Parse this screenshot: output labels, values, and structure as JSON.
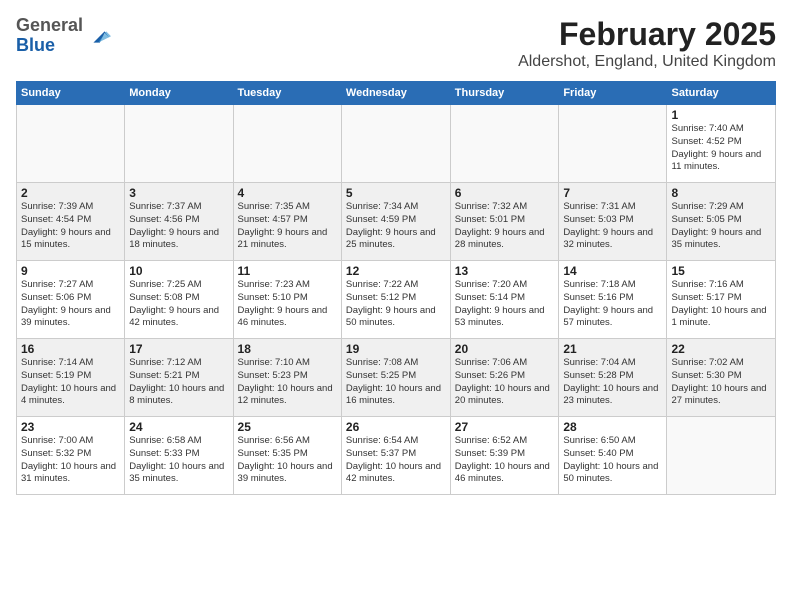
{
  "header": {
    "logo_general": "General",
    "logo_blue": "Blue",
    "title": "February 2025",
    "subtitle": "Aldershot, England, United Kingdom"
  },
  "calendar": {
    "days_of_week": [
      "Sunday",
      "Monday",
      "Tuesday",
      "Wednesday",
      "Thursday",
      "Friday",
      "Saturday"
    ],
    "weeks": [
      [
        {
          "day": "",
          "info": ""
        },
        {
          "day": "",
          "info": ""
        },
        {
          "day": "",
          "info": ""
        },
        {
          "day": "",
          "info": ""
        },
        {
          "day": "",
          "info": ""
        },
        {
          "day": "",
          "info": ""
        },
        {
          "day": "1",
          "info": "Sunrise: 7:40 AM\nSunset: 4:52 PM\nDaylight: 9 hours and 11 minutes."
        }
      ],
      [
        {
          "day": "2",
          "info": "Sunrise: 7:39 AM\nSunset: 4:54 PM\nDaylight: 9 hours and 15 minutes."
        },
        {
          "day": "3",
          "info": "Sunrise: 7:37 AM\nSunset: 4:56 PM\nDaylight: 9 hours and 18 minutes."
        },
        {
          "day": "4",
          "info": "Sunrise: 7:35 AM\nSunset: 4:57 PM\nDaylight: 9 hours and 21 minutes."
        },
        {
          "day": "5",
          "info": "Sunrise: 7:34 AM\nSunset: 4:59 PM\nDaylight: 9 hours and 25 minutes."
        },
        {
          "day": "6",
          "info": "Sunrise: 7:32 AM\nSunset: 5:01 PM\nDaylight: 9 hours and 28 minutes."
        },
        {
          "day": "7",
          "info": "Sunrise: 7:31 AM\nSunset: 5:03 PM\nDaylight: 9 hours and 32 minutes."
        },
        {
          "day": "8",
          "info": "Sunrise: 7:29 AM\nSunset: 5:05 PM\nDaylight: 9 hours and 35 minutes."
        }
      ],
      [
        {
          "day": "9",
          "info": "Sunrise: 7:27 AM\nSunset: 5:06 PM\nDaylight: 9 hours and 39 minutes."
        },
        {
          "day": "10",
          "info": "Sunrise: 7:25 AM\nSunset: 5:08 PM\nDaylight: 9 hours and 42 minutes."
        },
        {
          "day": "11",
          "info": "Sunrise: 7:23 AM\nSunset: 5:10 PM\nDaylight: 9 hours and 46 minutes."
        },
        {
          "day": "12",
          "info": "Sunrise: 7:22 AM\nSunset: 5:12 PM\nDaylight: 9 hours and 50 minutes."
        },
        {
          "day": "13",
          "info": "Sunrise: 7:20 AM\nSunset: 5:14 PM\nDaylight: 9 hours and 53 minutes."
        },
        {
          "day": "14",
          "info": "Sunrise: 7:18 AM\nSunset: 5:16 PM\nDaylight: 9 hours and 57 minutes."
        },
        {
          "day": "15",
          "info": "Sunrise: 7:16 AM\nSunset: 5:17 PM\nDaylight: 10 hours and 1 minute."
        }
      ],
      [
        {
          "day": "16",
          "info": "Sunrise: 7:14 AM\nSunset: 5:19 PM\nDaylight: 10 hours and 4 minutes."
        },
        {
          "day": "17",
          "info": "Sunrise: 7:12 AM\nSunset: 5:21 PM\nDaylight: 10 hours and 8 minutes."
        },
        {
          "day": "18",
          "info": "Sunrise: 7:10 AM\nSunset: 5:23 PM\nDaylight: 10 hours and 12 minutes."
        },
        {
          "day": "19",
          "info": "Sunrise: 7:08 AM\nSunset: 5:25 PM\nDaylight: 10 hours and 16 minutes."
        },
        {
          "day": "20",
          "info": "Sunrise: 7:06 AM\nSunset: 5:26 PM\nDaylight: 10 hours and 20 minutes."
        },
        {
          "day": "21",
          "info": "Sunrise: 7:04 AM\nSunset: 5:28 PM\nDaylight: 10 hours and 23 minutes."
        },
        {
          "day": "22",
          "info": "Sunrise: 7:02 AM\nSunset: 5:30 PM\nDaylight: 10 hours and 27 minutes."
        }
      ],
      [
        {
          "day": "23",
          "info": "Sunrise: 7:00 AM\nSunset: 5:32 PM\nDaylight: 10 hours and 31 minutes."
        },
        {
          "day": "24",
          "info": "Sunrise: 6:58 AM\nSunset: 5:33 PM\nDaylight: 10 hours and 35 minutes."
        },
        {
          "day": "25",
          "info": "Sunrise: 6:56 AM\nSunset: 5:35 PM\nDaylight: 10 hours and 39 minutes."
        },
        {
          "day": "26",
          "info": "Sunrise: 6:54 AM\nSunset: 5:37 PM\nDaylight: 10 hours and 42 minutes."
        },
        {
          "day": "27",
          "info": "Sunrise: 6:52 AM\nSunset: 5:39 PM\nDaylight: 10 hours and 46 minutes."
        },
        {
          "day": "28",
          "info": "Sunrise: 6:50 AM\nSunset: 5:40 PM\nDaylight: 10 hours and 50 minutes."
        },
        {
          "day": "",
          "info": ""
        }
      ]
    ]
  }
}
